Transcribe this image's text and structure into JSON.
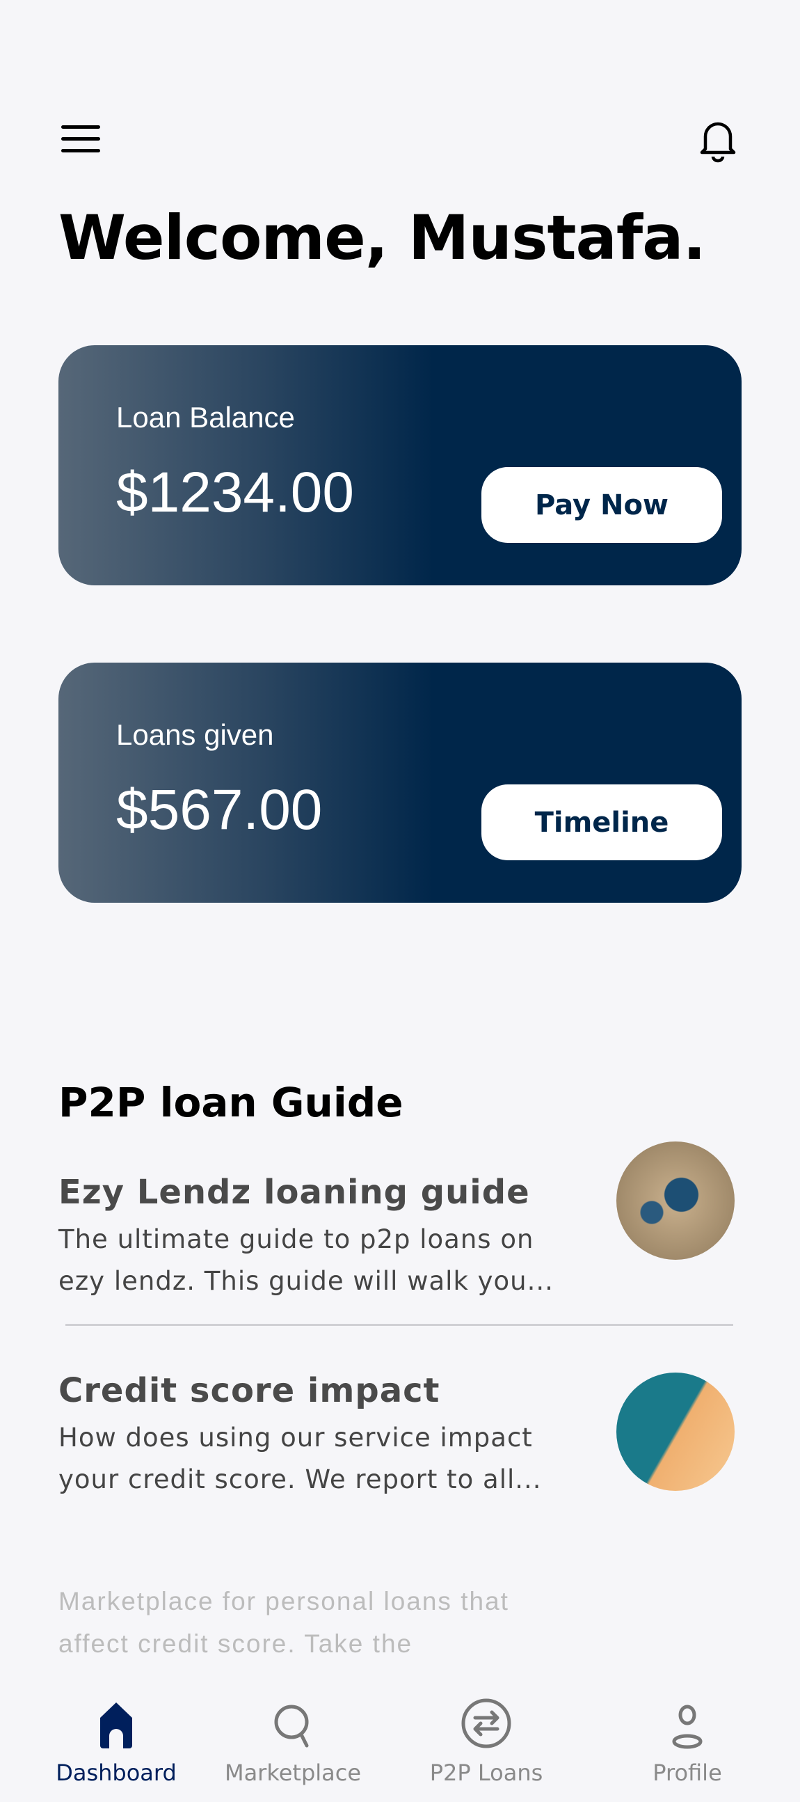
{
  "header": {
    "menu_icon": "hamburger-icon",
    "notification_icon": "bell-icon",
    "welcome": "Welcome, Mustafa."
  },
  "cards": [
    {
      "label": "Loan Balance",
      "amount": "$1234.00",
      "button": "Pay Now"
    },
    {
      "label": "Loans given",
      "amount": "$567.00",
      "button": "Timeline"
    }
  ],
  "guide": {
    "title": "P2P loan Guide",
    "items": [
      {
        "title": "Ezy Lendz loaning guide",
        "desc": "The ultimate guide to p2p loans on ezy lendz. This guide will walk you..."
      },
      {
        "title": "Credit score impact",
        "desc": "How does using our service impact your credit score. We report to all..."
      }
    ],
    "faded_text": "Marketplace for personal loans that affect credit score. Take the"
  },
  "nav": [
    {
      "label": "Dashboard",
      "icon": "home-icon",
      "active": true
    },
    {
      "label": "Marketplace",
      "icon": "search-icon"
    },
    {
      "label": "P2P Loans",
      "icon": "exchange-icon"
    },
    {
      "label": "Profile",
      "icon": "user-icon"
    }
  ],
  "colors": {
    "primary": "#00264a",
    "active_nav": "#001f5c",
    "background": "#f6f6f9"
  }
}
